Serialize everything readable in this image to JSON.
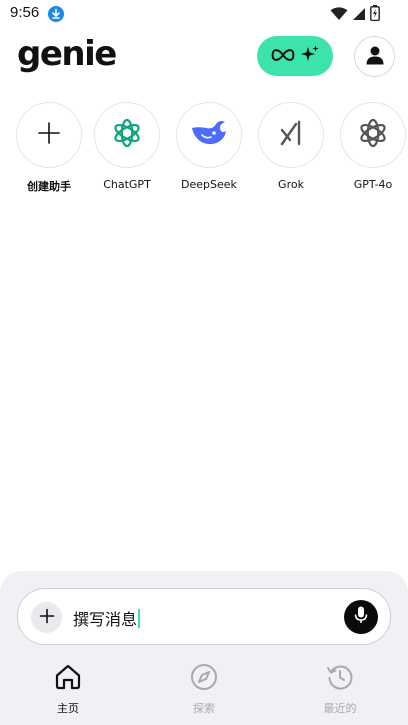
{
  "status_bar": {
    "time": "9:56",
    "icons": [
      "download-icon",
      "wifi-icon",
      "signal-icon",
      "battery-icon"
    ]
  },
  "header": {
    "logo": "genie",
    "premium_icons": [
      "infinity-icon",
      "sparkle-icon"
    ],
    "accent_color": "#3de3ad"
  },
  "assistants": [
    {
      "label": "创建助手",
      "icon": "plus-icon"
    },
    {
      "label": "ChatGPT",
      "icon": "openai-icon",
      "color": "#10a37f"
    },
    {
      "label": "DeepSeek",
      "icon": "deepseek-whale-icon",
      "color": "#4d6bfe"
    },
    {
      "label": "Grok",
      "icon": "grok-icon",
      "color": "#555555"
    },
    {
      "label": "GPT-4o",
      "icon": "openai-icon",
      "color": "#555555"
    }
  ],
  "composer": {
    "value": "撰写消息"
  },
  "nav": [
    {
      "label": "主页",
      "icon": "home-icon",
      "active": true
    },
    {
      "label": "探索",
      "icon": "compass-icon",
      "active": false
    },
    {
      "label": "最近的",
      "icon": "history-icon",
      "active": false
    }
  ]
}
